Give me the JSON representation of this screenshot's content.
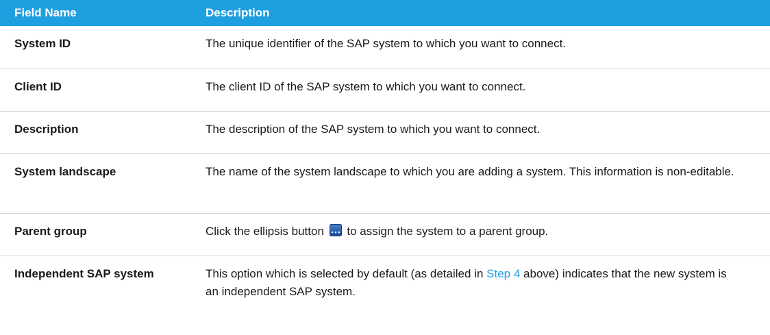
{
  "table": {
    "headers": [
      "Field Name",
      "Description"
    ],
    "rows": [
      {
        "name": "System ID",
        "description": "The unique identifier of the SAP system to which you want to connect."
      },
      {
        "name": "Client ID",
        "description": "The client ID of the SAP system to which you want to connect."
      },
      {
        "name": "Description",
        "description": "The description of the SAP system to which you want to connect."
      },
      {
        "name": "System landscape",
        "description": "The name of the system landscape to which you are adding a system. This information is non-editable."
      },
      {
        "name": "Parent group",
        "description_before": "Click the ellipsis button",
        "icon": "ellipsis-button-icon",
        "description_after": "to assign the system to a parent group."
      },
      {
        "name": "Independent SAP system",
        "description_before": "This option which is selected by default (as detailed in",
        "link_text": "Step 4",
        "description_after": "above) indicates that the new system is an independent SAP system."
      }
    ]
  },
  "colors": {
    "header_bg": "#1e9fe0",
    "header_text": "#ffffff",
    "link": "#1e9fe0",
    "row_border": "#d6d6d6"
  }
}
